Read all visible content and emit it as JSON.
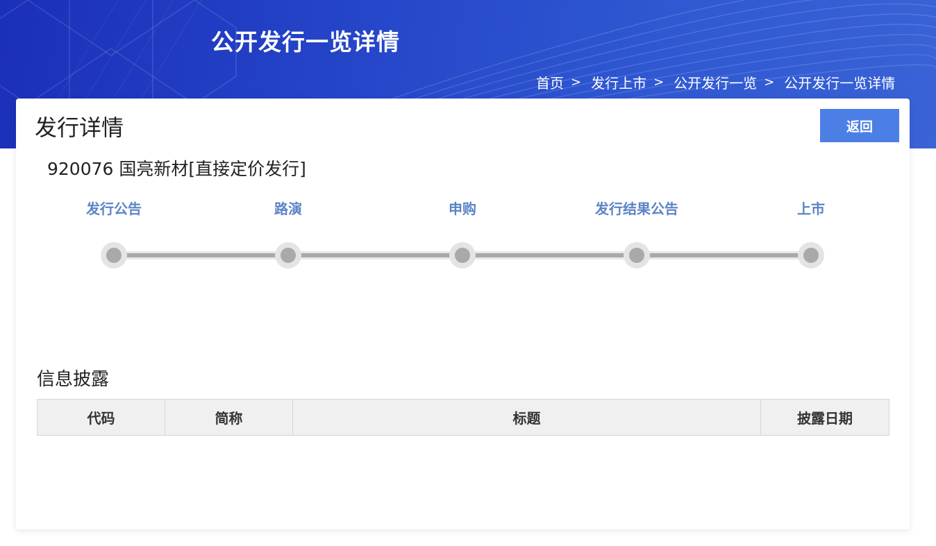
{
  "banner": {
    "title": "公开发行一览详情",
    "breadcrumb": [
      {
        "label": "首页"
      },
      {
        "label": "发行上市"
      },
      {
        "label": "公开发行一览"
      },
      {
        "label": "公开发行一览详情"
      }
    ],
    "separator": ">"
  },
  "card": {
    "title": "发行详情",
    "back_label": "返回",
    "stock_title": "920076 国亮新材[直接定价发行]",
    "steps": [
      {
        "label": "发行公告"
      },
      {
        "label": "路演"
      },
      {
        "label": "申购"
      },
      {
        "label": "发行结果公告"
      },
      {
        "label": "上市"
      }
    ]
  },
  "disclosure": {
    "title": "信息披露",
    "columns": [
      "代码",
      "简称",
      "标题",
      "披露日期"
    ]
  },
  "colors": {
    "banner_blue": "#2444c8",
    "button_blue": "#4c7fe6",
    "step_label": "#5b84c4"
  }
}
